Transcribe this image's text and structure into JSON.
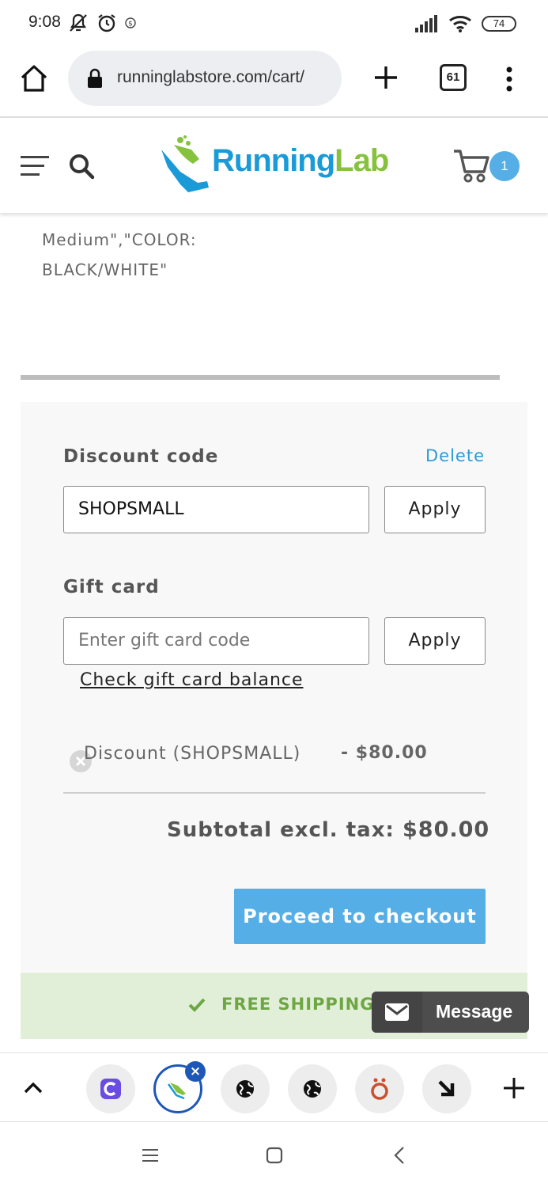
{
  "status_bar": {
    "time": "9:08",
    "battery": "74"
  },
  "browser": {
    "url": "runninglabstore.com/cart/",
    "tab_count": "61"
  },
  "site": {
    "logo_running": "Running",
    "logo_lab": "Lab",
    "cart_count": "1",
    "brand_blue": "#1a9ad6",
    "brand_green": "#86c23e"
  },
  "cart_item": {
    "variant_line1": "Medium\",\"COLOR:",
    "variant_line2": "BLACK/WHITE\""
  },
  "discount": {
    "label": "Discount code",
    "delete_label": "Delete",
    "input_value": "SHOPSMALL",
    "apply_label": "Apply"
  },
  "gift_card": {
    "label": "Gift card",
    "placeholder": "Enter gift card code",
    "apply_label": "Apply",
    "check_balance_icon": "",
    "check_balance": "Check gift card balance"
  },
  "totals": {
    "discount_label": "Discount (SHOPSMALL)",
    "discount_amount": "- $80.00",
    "subtotal_label": "Subtotal excl. tax:",
    "subtotal_value": "$80.00"
  },
  "checkout": {
    "label": "Proceed to checkout",
    "color": "#55aee6"
  },
  "shipping_banner": {
    "text": "FREE SHIPPING",
    "color": "#6da642"
  },
  "chat": {
    "label": "Message"
  },
  "tab_strip": {
    "tabs": [
      "copy-app-icon",
      "runninglab-favicon",
      "globe-icon",
      "globe-icon",
      "o-umlaut-icon",
      "arrow-down-right-icon"
    ]
  }
}
